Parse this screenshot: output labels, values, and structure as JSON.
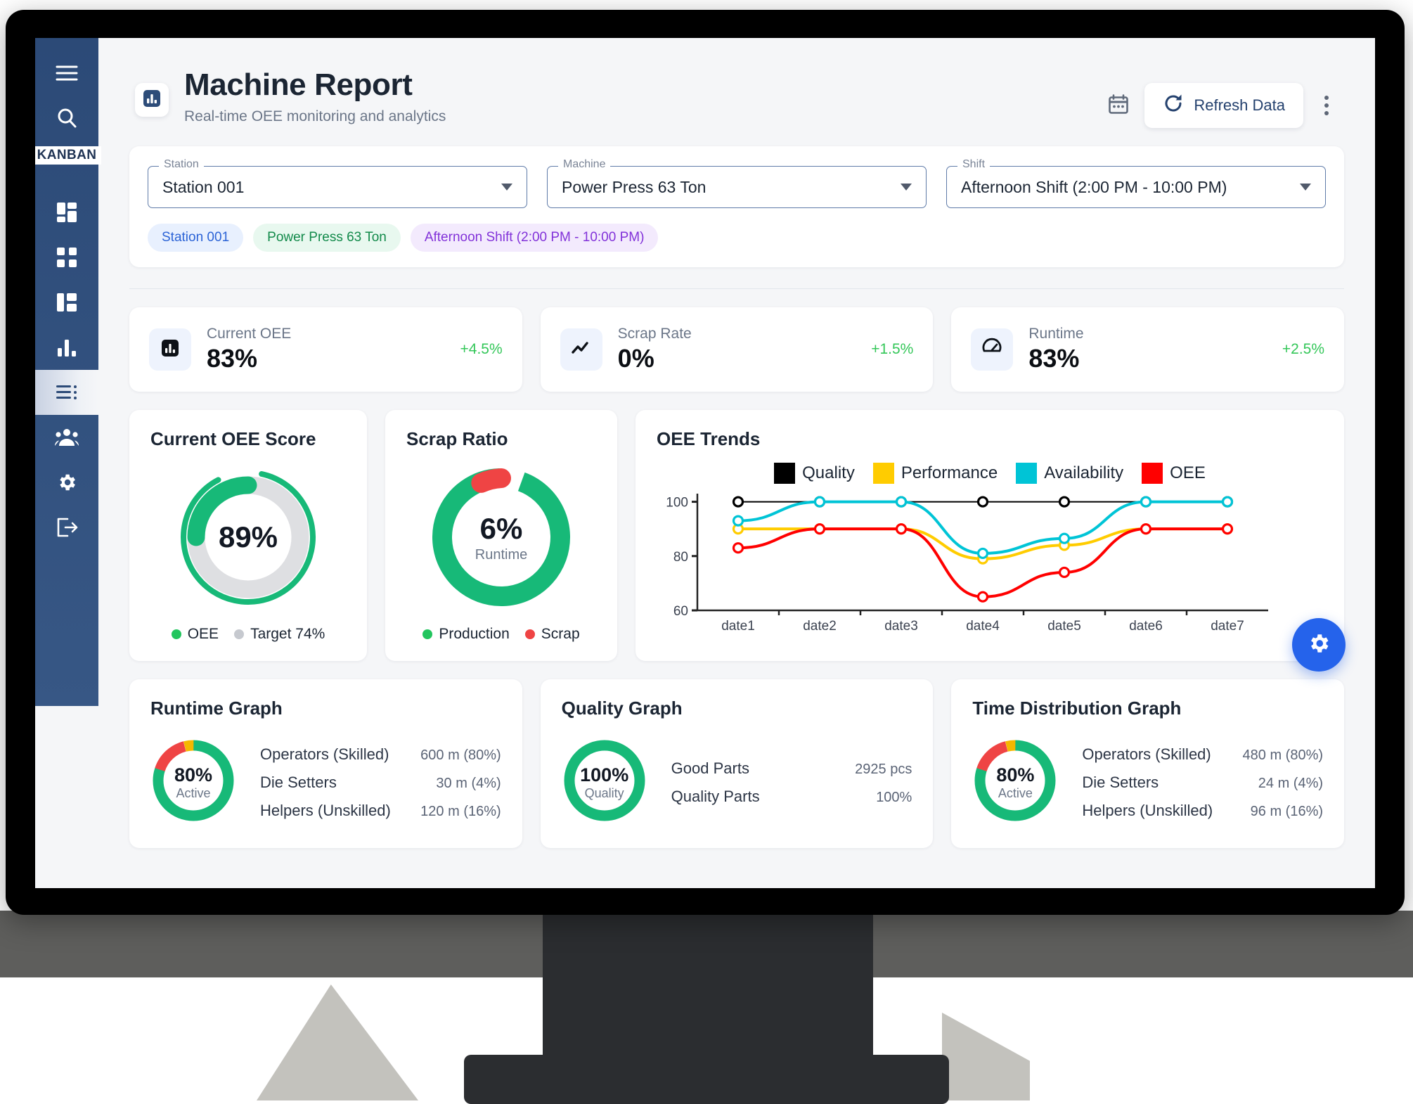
{
  "sidebar": {
    "badge": "KANBAN",
    "items": [
      {
        "name": "menu",
        "icon": "hamburger-icon"
      },
      {
        "name": "search",
        "icon": "search-icon"
      },
      {
        "name": "dashboard",
        "icon": "dashboard-grid-icon"
      },
      {
        "name": "apps",
        "icon": "apps-grid-icon"
      },
      {
        "name": "layout",
        "icon": "layout-panel-icon"
      },
      {
        "name": "analytics",
        "icon": "bar-chart-icon"
      },
      {
        "name": "reports",
        "icon": "list-report-icon"
      },
      {
        "name": "users",
        "icon": "people-icon"
      },
      {
        "name": "settings",
        "icon": "gear-icon"
      },
      {
        "name": "logout",
        "icon": "logout-icon"
      }
    ]
  },
  "header": {
    "icon": "bar-chart-icon",
    "title": "Machine Report",
    "subtitle": "Real-time OEE monitoring and analytics",
    "calendar_icon": "calendar-icon",
    "refresh_icon": "refresh-icon",
    "refresh_label": "Refresh Data",
    "kebab_icon": "more-vertical-icon"
  },
  "filters": {
    "station": {
      "label": "Station",
      "value": "Station 001"
    },
    "machine": {
      "label": "Machine",
      "value": "Power Press 63 Ton"
    },
    "shift": {
      "label": "Shift",
      "value": "Afternoon Shift (2:00 PM - 10:00 PM)"
    },
    "chips": [
      {
        "text": "Station 001",
        "color": "#2b63d6"
      },
      {
        "text": "Power Press 63 Ton",
        "color": "#128a4a"
      },
      {
        "text": "Afternoon Shift (2:00 PM - 10:00 PM)",
        "color": "#8232d9"
      }
    ]
  },
  "kpis": [
    {
      "icon": "bar-chart-icon",
      "label": "Current OEE",
      "value": "83%",
      "delta": "+4.5%"
    },
    {
      "icon": "trend-line-icon",
      "label": "Scrap Rate",
      "value": "0%",
      "delta": "+1.5%"
    },
    {
      "icon": "gauge-icon",
      "label": "Runtime",
      "value": "83%",
      "delta": "+2.5%"
    }
  ],
  "oee_score": {
    "title": "Current OEE Score",
    "value": "89%",
    "legend": [
      {
        "label": "OEE",
        "color": "#22c55e"
      },
      {
        "label": "Target 74%",
        "color": "#c6c9cf"
      }
    ]
  },
  "scrap_ratio": {
    "title": "Scrap Ratio",
    "value": "6%",
    "sub": "Runtime",
    "legend": [
      {
        "label": "Production",
        "color": "#22c55e"
      },
      {
        "label": "Scrap",
        "color": "#ef4444"
      }
    ]
  },
  "trends": {
    "title": "OEE Trends"
  },
  "bottom_cards": [
    {
      "title": "Runtime Graph",
      "center_value": "80%",
      "center_sub": "Active",
      "rows": [
        {
          "name": "Operators (Skilled)",
          "value": "600 m (80%)"
        },
        {
          "name": "Die Setters",
          "value": "30 m (4%)"
        },
        {
          "name": "Helpers (Unskilled)",
          "value": "120 m (16%)"
        }
      ]
    },
    {
      "title": "Quality Graph",
      "center_value": "100%",
      "center_sub": "Quality",
      "rows": [
        {
          "name": "Good Parts",
          "value": "2925 pcs"
        },
        {
          "name": "Quality Parts",
          "value": "100%"
        }
      ]
    },
    {
      "title": "Time Distribution Graph",
      "center_value": "80%",
      "center_sub": "Active",
      "rows": [
        {
          "name": "Operators (Skilled)",
          "value": "480 m (80%)"
        },
        {
          "name": "Die Setters",
          "value": "24 m (4%)"
        },
        {
          "name": "Helpers (Unskilled)",
          "value": "96 m (16%)"
        }
      ]
    }
  ],
  "fab": {
    "icon": "gear-icon"
  },
  "colors": {
    "quality": "#000000",
    "performance": "#ffcc00",
    "availability": "#00c4d6",
    "oee": "#ff0000",
    "green": "#17b978",
    "green_bright": "#22c55e",
    "red": "#ef4444",
    "amber": "#f5b700",
    "grey_track": "#dddfe3",
    "accent_blue": "#2563eb",
    "sidebar": "#2c4a77"
  },
  "chart_data": {
    "type": "line",
    "title": "OEE Trends",
    "xlabel": "",
    "ylabel": "",
    "x": [
      "date1",
      "date2",
      "date3",
      "date4",
      "date5",
      "date6",
      "date7"
    ],
    "yticks": [
      60,
      80,
      100
    ],
    "ylim": [
      60,
      103
    ],
    "grid": false,
    "legend_position": "top-center",
    "series": [
      {
        "name": "Quality",
        "color": "#000000",
        "values": [
          100,
          100,
          100,
          100,
          100,
          100,
          100
        ]
      },
      {
        "name": "Performance",
        "color": "#ffcc00",
        "values": [
          90,
          90,
          90,
          79,
          84,
          90,
          90
        ]
      },
      {
        "name": "Availability",
        "color": "#00c4d6",
        "values": [
          93,
          100,
          100,
          81,
          86.5,
          100,
          100
        ]
      },
      {
        "name": "OEE",
        "color": "#ff0000",
        "values": [
          83,
          90,
          90,
          65,
          74,
          90,
          90
        ]
      }
    ]
  },
  "donut_data": [
    {
      "name": "oee-score",
      "type": "gauge",
      "outer_value": 89,
      "inner_target": 74,
      "max": 100
    },
    {
      "name": "scrap-ratio",
      "type": "pie",
      "slices": [
        {
          "label": "Production",
          "value": 94
        },
        {
          "label": "Scrap",
          "value": 6
        }
      ]
    },
    {
      "name": "runtime-graph",
      "type": "pie",
      "slices": [
        {
          "label": "Operators (Skilled)",
          "value": 80
        },
        {
          "label": "Helpers (Unskilled)",
          "value": 16
        },
        {
          "label": "Die Setters",
          "value": 4
        }
      ]
    },
    {
      "name": "quality-graph",
      "type": "pie",
      "slices": [
        {
          "label": "Quality",
          "value": 100
        }
      ]
    },
    {
      "name": "time-distribution-graph",
      "type": "pie",
      "slices": [
        {
          "label": "Operators (Skilled)",
          "value": 80
        },
        {
          "label": "Helpers (Unskilled)",
          "value": 16
        },
        {
          "label": "Die Setters",
          "value": 4
        }
      ]
    }
  ]
}
